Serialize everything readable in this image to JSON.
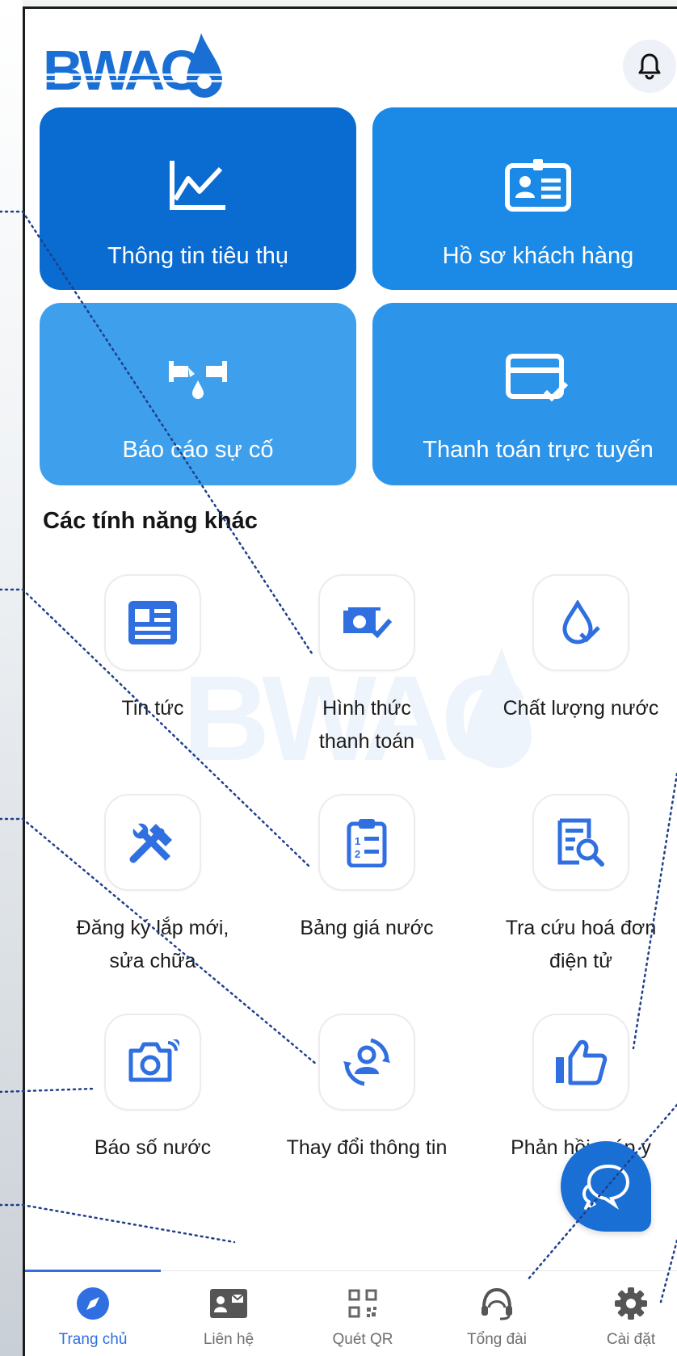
{
  "brand": {
    "logo_text": "BWACO",
    "primary_color": "#1a6fd4",
    "accent_color": "#2f6fe0"
  },
  "header": {
    "notification_icon": "bell-icon"
  },
  "tiles": [
    {
      "label": "Thông tin tiêu thụ",
      "icon": "line-chart-icon",
      "color": "#0a6bd0"
    },
    {
      "label": "Hồ sơ khách hàng",
      "icon": "id-card-icon",
      "color": "#1a8ae6"
    },
    {
      "label": "Báo cáo sự cố",
      "icon": "pipe-leak-icon",
      "color": "#3ea0ed"
    },
    {
      "label": "Thanh toán trực tuyến",
      "icon": "card-check-icon",
      "color": "#2c95ea"
    }
  ],
  "section_title": "Các tính năng khác",
  "features": [
    {
      "label": "Tin tức",
      "icon": "news-icon"
    },
    {
      "label": "Hình thức\nthanh toán",
      "icon": "payment-method-icon"
    },
    {
      "label": "Chất lượng nước",
      "icon": "water-drop-check-icon"
    },
    {
      "label": "Đăng ký lắp mới,\nsửa chữa",
      "icon": "tools-icon"
    },
    {
      "label": "Bảng giá nước",
      "icon": "clipboard-list-icon"
    },
    {
      "label": "Tra cứu hoá đơn\nđiện tử",
      "icon": "invoice-search-icon"
    },
    {
      "label": "Báo số nước",
      "icon": "camera-icon"
    },
    {
      "label": "Thay đổi thông tin",
      "icon": "user-refresh-icon"
    },
    {
      "label": "Phản hồi, góp ý",
      "icon": "thumbs-up-icon"
    }
  ],
  "chat_button": {
    "icon": "chat-bubbles-icon"
  },
  "bottom_nav": [
    {
      "label": "Trang chủ",
      "icon": "compass-icon",
      "active": true
    },
    {
      "label": "Liên hệ",
      "icon": "contact-card-icon",
      "active": false
    },
    {
      "label": "Quét QR",
      "icon": "qr-code-icon",
      "active": false
    },
    {
      "label": "Tổng đài",
      "icon": "headset-icon",
      "active": false
    },
    {
      "label": "Cài đặt",
      "icon": "gear-icon",
      "active": false
    }
  ]
}
